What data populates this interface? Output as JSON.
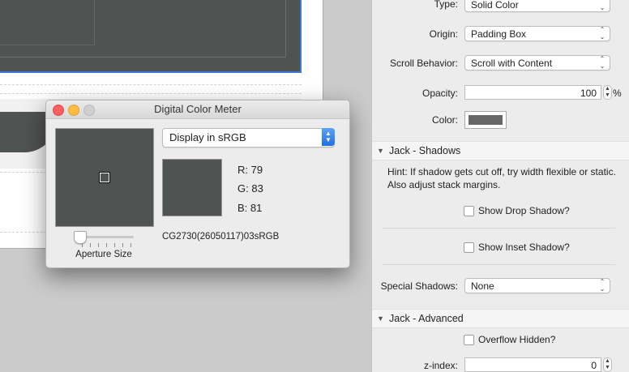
{
  "meter": {
    "title": "Digital Color Meter",
    "display_mode": "Display in sRGB",
    "aperture_label": "Aperture Size",
    "aperture_level": 0,
    "r_text": "R: 79",
    "g_text": "G: 83",
    "b_text": "B: 81",
    "color_spec": "CG2730(26050117)03sRGB",
    "sample_color": "#4f5351"
  },
  "inspector": {
    "type": {
      "label": "Type:",
      "value": "Solid Color"
    },
    "origin": {
      "label": "Origin:",
      "value": "Padding Box"
    },
    "scroll_behavior": {
      "label": "Scroll Behavior:",
      "value": "Scroll with Content"
    },
    "opacity": {
      "label": "Opacity:",
      "value": "100",
      "unit": "%"
    },
    "color": {
      "label": "Color:",
      "swatch": "#666666"
    },
    "shadows": {
      "title": "Jack - Shadows",
      "hint": "Hint: If shadow gets cut off, try width flexible or static. Also adjust stack margins.",
      "drop_shadow_label": "Show Drop Shadow?",
      "drop_shadow_checked": false,
      "inset_shadow_label": "Show Inset Shadow?",
      "inset_shadow_checked": false,
      "special_label": "Special Shadows:",
      "special_value": "None"
    },
    "advanced": {
      "title": "Jack - Advanced",
      "overflow_label": "Overflow Hidden?",
      "overflow_checked": false,
      "zindex_label": "z-index:",
      "zindex_value": "0"
    }
  }
}
